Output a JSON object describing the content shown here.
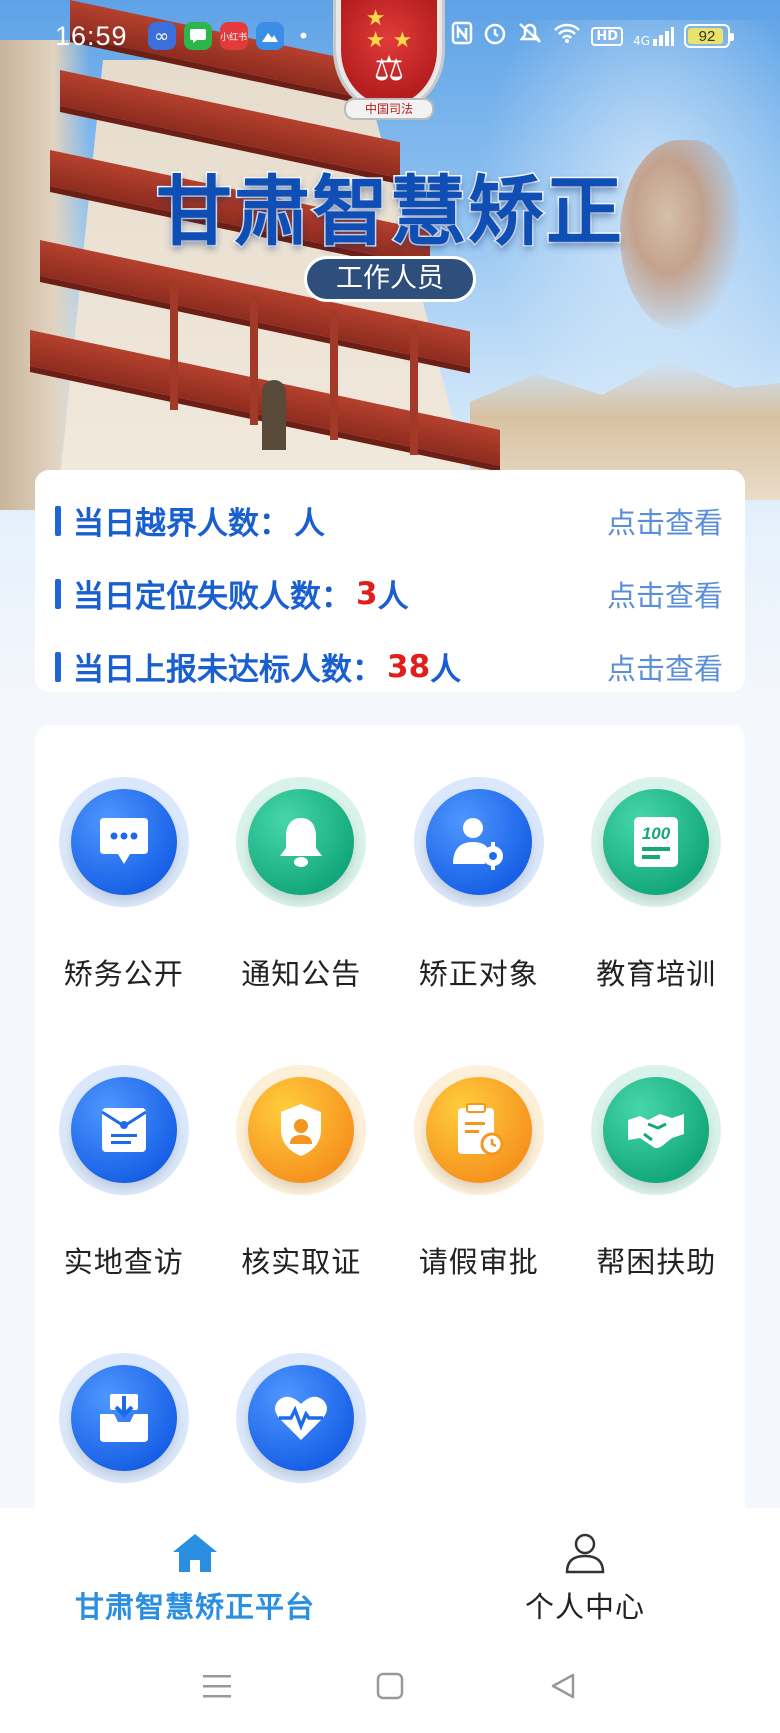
{
  "status_bar": {
    "time": "16:59",
    "apps": [
      "infinity-app",
      "chat-app",
      "red-app",
      "picture-app"
    ],
    "red_app_text": "小红书",
    "hd": "HD",
    "network": "4G",
    "battery": "92"
  },
  "header": {
    "emblem_text": "中国司法",
    "title": "甘肃智慧矫正",
    "role": "工作人员"
  },
  "stats": [
    {
      "label": "当日越界人数：",
      "value": "",
      "unit": "人",
      "link": "点击查看"
    },
    {
      "label": "当日定位失败人数：",
      "value": "3",
      "unit": "人",
      "link": "点击查看"
    },
    {
      "label": "当日上报未达标人数：",
      "value": "38",
      "unit": "人",
      "link": "点击查看"
    }
  ],
  "menu": [
    {
      "label": "矫务公开",
      "icon": "chat-bubble-icon",
      "color": "blue"
    },
    {
      "label": "通知公告",
      "icon": "bell-icon",
      "color": "green"
    },
    {
      "label": "矫正对象",
      "icon": "user-gear-icon",
      "color": "blue"
    },
    {
      "label": "教育培训",
      "icon": "score-sheet-icon",
      "color": "green"
    },
    {
      "label": "实地查访",
      "icon": "envelope-icon",
      "color": "blue"
    },
    {
      "label": "核实取证",
      "icon": "shield-person-icon",
      "color": "orange"
    },
    {
      "label": "请假审批",
      "icon": "clipboard-clock-icon",
      "color": "orange"
    },
    {
      "label": "帮困扶助",
      "icon": "handshake-icon",
      "color": "green"
    },
    {
      "label": "",
      "icon": "download-tray-icon",
      "color": "blue"
    },
    {
      "label": "",
      "icon": "heart-pulse-icon",
      "color": "blue"
    }
  ],
  "bottom_nav": {
    "home_label": "甘肃智慧矫正平台",
    "profile_label": "个人中心"
  },
  "colors": {
    "primary_blue": "#1a5fcf",
    "alert_red": "#e01e1e",
    "nav_active": "#2a8fe0"
  }
}
